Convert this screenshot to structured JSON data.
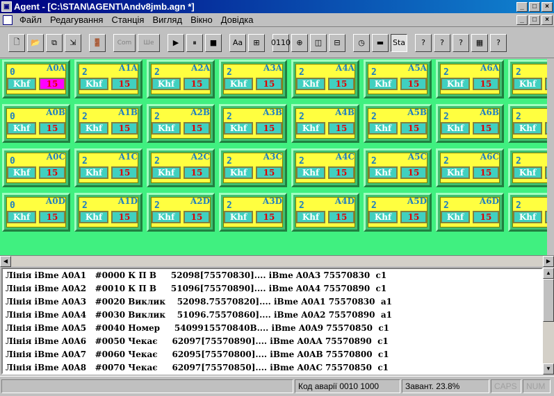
{
  "window": {
    "title": "Agent - [C:\\STAN\\AGENT\\Andv8jmb.agn *]",
    "app_icon": "agent-app-icon",
    "controls": [
      "_",
      "□",
      "×"
    ],
    "doc_controls": [
      "_",
      "□",
      "×"
    ]
  },
  "menu": {
    "items": [
      {
        "label": "Файл"
      },
      {
        "label": "Редагування"
      },
      {
        "label": "Станція"
      },
      {
        "label": "Вигляд"
      },
      {
        "label": "Вікно"
      },
      {
        "label": "Довідка"
      }
    ]
  },
  "toolbar": {
    "buttons": [
      {
        "icon": "new-file-icon",
        "glyph": "🗋"
      },
      {
        "icon": "open-folder-icon",
        "glyph": "📂"
      },
      {
        "icon": "copy-icon",
        "glyph": "⧉"
      },
      {
        "icon": "export-icon",
        "glyph": "⇲"
      },
      {
        "icon": "exit-door-icon",
        "glyph": "🚪"
      },
      {
        "icon": "com-port-icon",
        "glyph": "Com"
      },
      {
        "icon": "shell-icon",
        "glyph": "Ше"
      },
      {
        "icon": "play-icon",
        "glyph": "▶"
      },
      {
        "icon": "pause-icon",
        "glyph": "⏸"
      },
      {
        "icon": "stop-icon",
        "glyph": "■"
      },
      {
        "icon": "font-case-icon",
        "glyph": "Aa"
      },
      {
        "icon": "network-icon",
        "glyph": "⊞"
      },
      {
        "icon": "binary-icon",
        "glyph": "0110"
      },
      {
        "icon": "connector-icon",
        "glyph": "⊕"
      },
      {
        "icon": "split-vertical-icon",
        "glyph": "◫"
      },
      {
        "icon": "split-horizontal-icon",
        "glyph": "⊟"
      },
      {
        "icon": "clock-icon",
        "glyph": "◷"
      },
      {
        "icon": "panel-icon",
        "glyph": "▬"
      },
      {
        "icon": "station-icon",
        "glyph": "Sta"
      },
      {
        "icon": "question-query-icon",
        "glyph": "?"
      },
      {
        "icon": "disabled-help-icon",
        "glyph": "?"
      },
      {
        "icon": "info-help-icon",
        "glyph": "?"
      },
      {
        "icon": "about-icon",
        "glyph": "▦"
      },
      {
        "icon": "context-help-icon",
        "glyph": "?"
      }
    ]
  },
  "stations": {
    "colors": {
      "background": "#40f080",
      "cell": "#ffff40",
      "counter": "#e00000",
      "highlight": "#ff00ff"
    },
    "rows": [
      [
        {
          "num": "0",
          "code": "A0A",
          "mode": "Khf",
          "value": "15",
          "alert": true
        },
        {
          "num": "2",
          "code": "A1A",
          "mode": "Khf",
          "value": "15",
          "alert": false
        },
        {
          "num": "2",
          "code": "A2A",
          "mode": "Khf",
          "value": "15",
          "alert": false
        },
        {
          "num": "2",
          "code": "A3A",
          "mode": "Khf",
          "value": "15",
          "alert": false
        },
        {
          "num": "2",
          "code": "A4A",
          "mode": "Khf",
          "value": "15",
          "alert": false
        },
        {
          "num": "2",
          "code": "A5A",
          "mode": "Khf",
          "value": "15",
          "alert": false
        },
        {
          "num": "2",
          "code": "A6A",
          "mode": "Khf",
          "value": "15",
          "alert": false
        },
        {
          "num": "2",
          "code": "A",
          "mode": "Khf",
          "value": "",
          "alert": false
        }
      ],
      [
        {
          "num": "0",
          "code": "A0B",
          "mode": "Khf",
          "value": "15",
          "alert": false
        },
        {
          "num": "2",
          "code": "A1B",
          "mode": "Khf",
          "value": "15",
          "alert": false
        },
        {
          "num": "2",
          "code": "A2B",
          "mode": "Khf",
          "value": "15",
          "alert": false
        },
        {
          "num": "2",
          "code": "A3B",
          "mode": "Khf",
          "value": "15",
          "alert": false
        },
        {
          "num": "2",
          "code": "A4B",
          "mode": "Khf",
          "value": "15",
          "alert": false
        },
        {
          "num": "2",
          "code": "A5B",
          "mode": "Khf",
          "value": "15",
          "alert": false
        },
        {
          "num": "2",
          "code": "A6B",
          "mode": "Khf",
          "value": "15",
          "alert": false
        },
        {
          "num": "2",
          "code": "A",
          "mode": "Khf",
          "value": "",
          "alert": false
        }
      ],
      [
        {
          "num": "0",
          "code": "A0C",
          "mode": "Khf",
          "value": "15",
          "alert": false
        },
        {
          "num": "2",
          "code": "A1C",
          "mode": "Khf",
          "value": "15",
          "alert": false
        },
        {
          "num": "2",
          "code": "A2C",
          "mode": "Khf",
          "value": "15",
          "alert": false
        },
        {
          "num": "2",
          "code": "A3C",
          "mode": "Khf",
          "value": "15",
          "alert": false
        },
        {
          "num": "2",
          "code": "A4C",
          "mode": "Khf",
          "value": "15",
          "alert": false
        },
        {
          "num": "2",
          "code": "A5C",
          "mode": "Khf",
          "value": "15",
          "alert": false
        },
        {
          "num": "2",
          "code": "A6C",
          "mode": "Khf",
          "value": "15",
          "alert": false
        },
        {
          "num": "2",
          "code": "A",
          "mode": "Khf",
          "value": "",
          "alert": false
        }
      ],
      [
        {
          "num": "0",
          "code": "A0D",
          "mode": "Khf",
          "value": "15",
          "alert": false
        },
        {
          "num": "2",
          "code": "A1D",
          "mode": "Khf",
          "value": "15",
          "alert": false
        },
        {
          "num": "2",
          "code": "A2D",
          "mode": "Khf",
          "value": "15",
          "alert": false
        },
        {
          "num": "2",
          "code": "A3D",
          "mode": "Khf",
          "value": "15",
          "alert": false
        },
        {
          "num": "2",
          "code": "A4D",
          "mode": "Khf",
          "value": "15",
          "alert": false
        },
        {
          "num": "2",
          "code": "A5D",
          "mode": "Khf",
          "value": "15",
          "alert": false
        },
        {
          "num": "2",
          "code": "A6D",
          "mode": "Khf",
          "value": "15",
          "alert": false
        },
        {
          "num": "2",
          "code": "A",
          "mode": "Khf",
          "value": "",
          "alert": false
        }
      ]
    ]
  },
  "log": {
    "rows": [
      "Лінія iBme A0A1   #0000 К П В     52098[75570830].... iBme A0A3 75570830  c1",
      "Лінія iBme A0A2   #0010 К П В     51096[75570890].... iBme A0A4 75570890  c1",
      "Лінія iBme A0A3   #0020 Виклик    52098.75570820].... iBme A0A1 75570830  a1",
      "Лінія iBme A0A4   #0030 Виклик    51096.75570860].... iBme A0A2 75570890  a1",
      "Лінія iBme A0A5   #0040 Номер     5409915570840B.... iBme A0A9 75570850  c1",
      "Лінія iBme A0A6   #0050 Чекає     62097[75570890].... iBme A0AA 75570890  c1",
      "Лінія iBme A0A7   #0060 Чекає     62095[75570800].... iBme A0AB 75570800  c1",
      "Лінія iBme A0A8   #0070 Чекає     62097[75570850].... iBme A0AC 75570850  c1"
    ]
  },
  "status": {
    "alarm": "Код аварії 0010 1000",
    "load": "Завант.  23.8%",
    "caps": "CAPS",
    "num": "NUM"
  }
}
